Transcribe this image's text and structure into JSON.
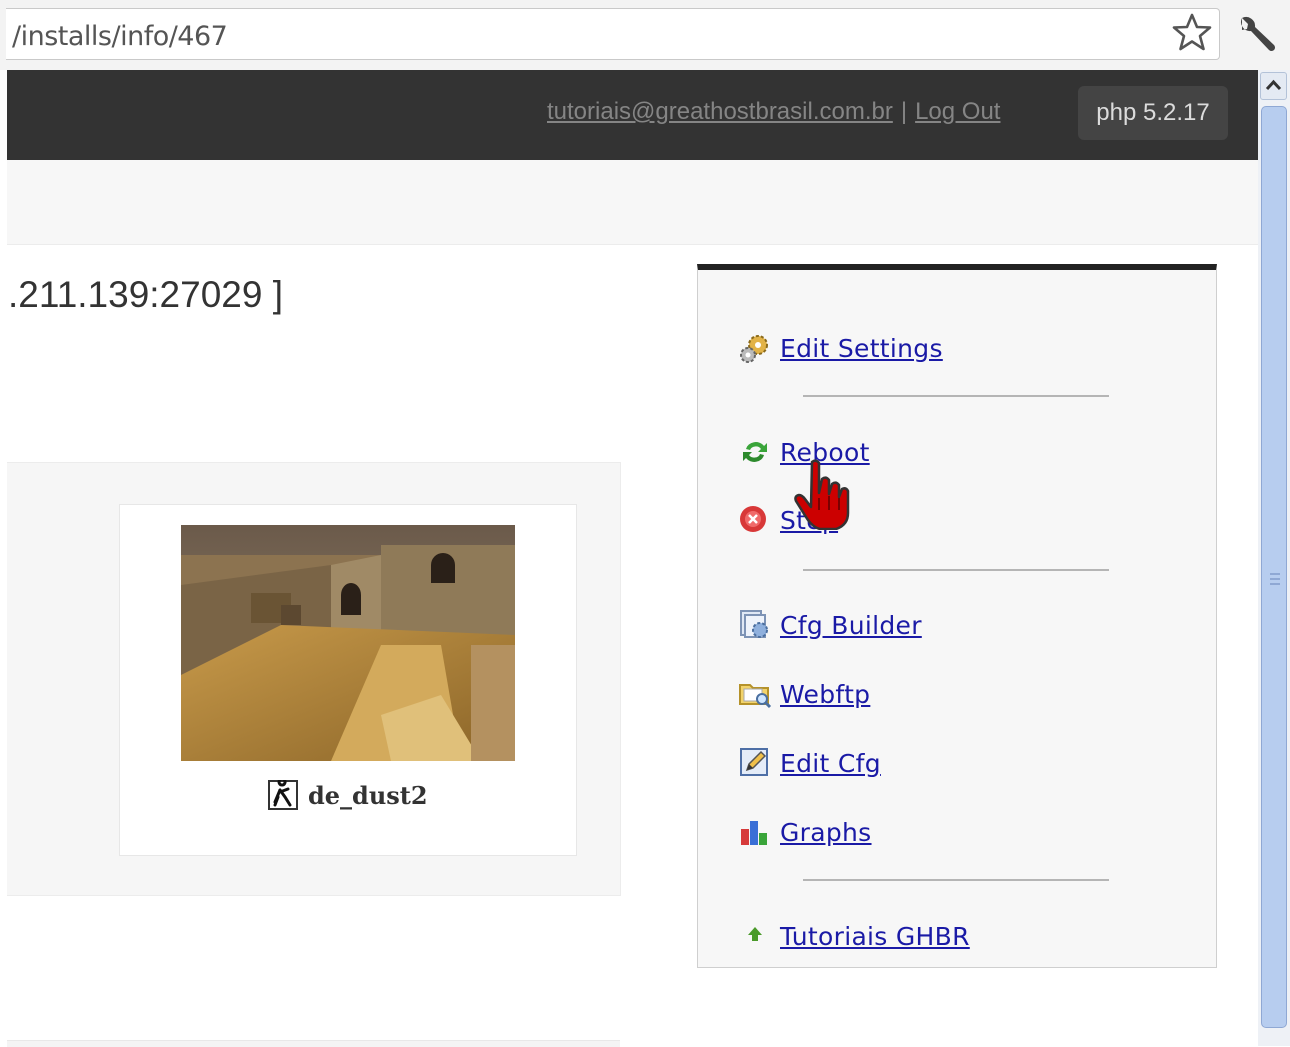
{
  "browser": {
    "url": "/installs/info/467",
    "bookmark_icon": "star-icon",
    "menu_icon": "wrench-icon"
  },
  "header": {
    "user_email": "tutoriais@greathostbrasil.com.br",
    "separator": "|",
    "logout_label": "Log Out",
    "php_version": "php 5.2.17"
  },
  "server": {
    "title": ".211.139:27029 ]",
    "map_name": "de_dust2",
    "map_image": "de_dust2 map preview",
    "game_icon": "counter-strike-icon"
  },
  "actions": {
    "edit_settings": "Edit Settings",
    "reboot": "Reboot",
    "stop": "Stop",
    "cfg_builder": "Cfg Builder",
    "webftp": "Webftp",
    "edit_cfg": "Edit Cfg",
    "graphs": "Graphs",
    "tutoriais": "Tutoriais GHBR"
  },
  "colors": {
    "link": "#1a1aa6",
    "header_bg": "#333333",
    "panel_top_border": "#222222",
    "cursor": "#cc0000"
  }
}
